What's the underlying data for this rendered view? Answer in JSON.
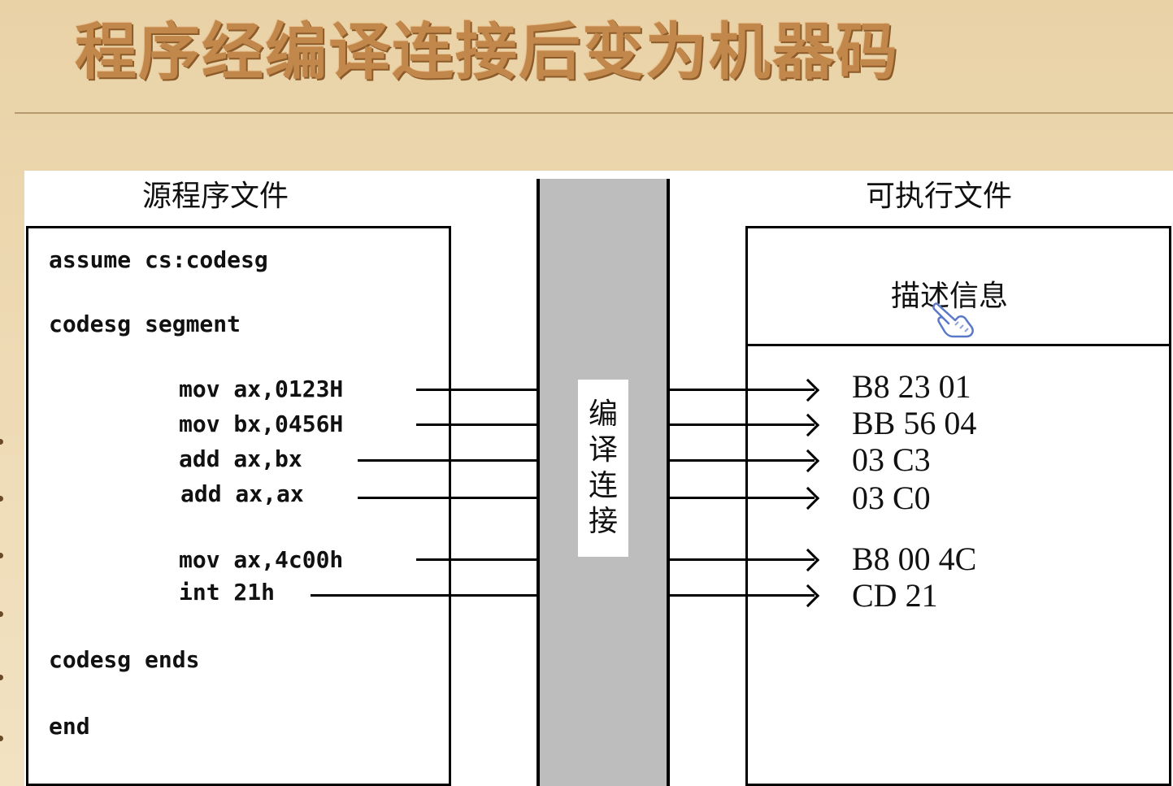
{
  "title": "程序经编译连接后变为机器码",
  "source_file": {
    "heading": "源程序文件",
    "lines": [
      "assume cs:codesg",
      "codesg segment",
      "mov ax,0123H",
      "mov bx,0456H",
      "add ax,bx",
      "add ax,ax",
      "mov ax,4c00h",
      "int 21h",
      "codesg ends",
      "end"
    ]
  },
  "process": {
    "chars": [
      "编",
      "译",
      "连",
      "接"
    ]
  },
  "executable_file": {
    "heading": "可执行文件",
    "description": "描述信息",
    "machine_code": [
      "B8 23 01",
      "BB 56 04",
      "03 C3",
      "03 C0",
      "B8 00 4C",
      "CD 21"
    ]
  },
  "icons": {
    "cursor": "hand-pointer-icon"
  }
}
